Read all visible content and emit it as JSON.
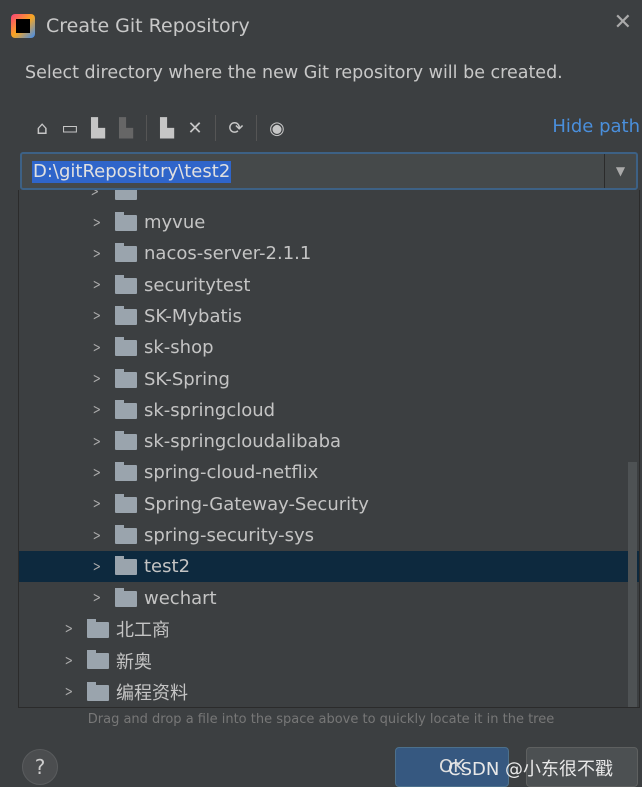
{
  "window": {
    "title": "Create Git Repository",
    "subtitle": "Select directory where the new Git repository will be created."
  },
  "toolbar": {
    "icons": [
      "home-icon",
      "desktop-icon",
      "project-folder-icon",
      "module-folder-icon",
      "new-folder-icon",
      "delete-icon",
      "refresh-icon",
      "show-hidden-icon"
    ],
    "hide_path": "Hide path"
  },
  "path": {
    "value": "D:\\gitRepository\\test2"
  },
  "tree": {
    "items": [
      {
        "label": "myvue",
        "depth": 1
      },
      {
        "label": "nacos-server-2.1.1",
        "depth": 1
      },
      {
        "label": "securitytest",
        "depth": 1
      },
      {
        "label": "SK-Mybatis",
        "depth": 1
      },
      {
        "label": "sk-shop",
        "depth": 1
      },
      {
        "label": "SK-Spring",
        "depth": 1
      },
      {
        "label": "sk-springcloud",
        "depth": 1
      },
      {
        "label": "sk-springcloudalibaba",
        "depth": 1
      },
      {
        "label": "spring-cloud-netflix",
        "depth": 1
      },
      {
        "label": "Spring-Gateway-Security",
        "depth": 1
      },
      {
        "label": "spring-security-sys",
        "depth": 1
      },
      {
        "label": "test2",
        "depth": 1,
        "selected": true
      },
      {
        "label": "wechart",
        "depth": 1
      },
      {
        "label": "北工商",
        "depth": 0
      },
      {
        "label": "新奥",
        "depth": 0
      },
      {
        "label": "编程资料",
        "depth": 0
      }
    ],
    "selected_color": "#0d293e"
  },
  "hint": "Drag and drop a file into the space above to quickly locate it in the tree",
  "buttons": {
    "help": "?",
    "ok": "OK"
  },
  "watermark": "CSDN @小东很不戳"
}
